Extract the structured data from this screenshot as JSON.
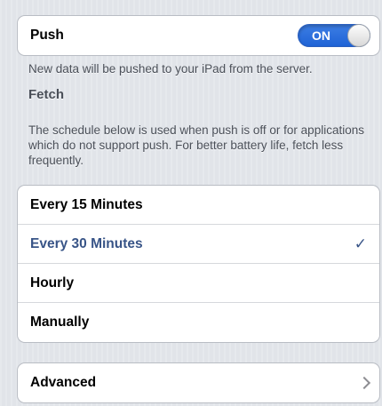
{
  "push": {
    "label": "Push",
    "toggle_text": "ON",
    "toggle_state": "on",
    "footnote": "New data will be pushed to your iPad from the server."
  },
  "fetch": {
    "header": "Fetch",
    "description": "The schedule below is used when push is off or for applications which do not support push. For better battery life, fetch less frequently.",
    "options": [
      {
        "label": "Every 15 Minutes",
        "selected": false
      },
      {
        "label": "Every 30 Minutes",
        "selected": true
      },
      {
        "label": "Hourly",
        "selected": false
      },
      {
        "label": "Manually",
        "selected": false
      }
    ],
    "check_mark": "✓"
  },
  "advanced": {
    "label": "Advanced"
  },
  "colors": {
    "background": "#e1e4e9",
    "selected_text": "#385487",
    "toggle_on": "#2a6ddc"
  }
}
